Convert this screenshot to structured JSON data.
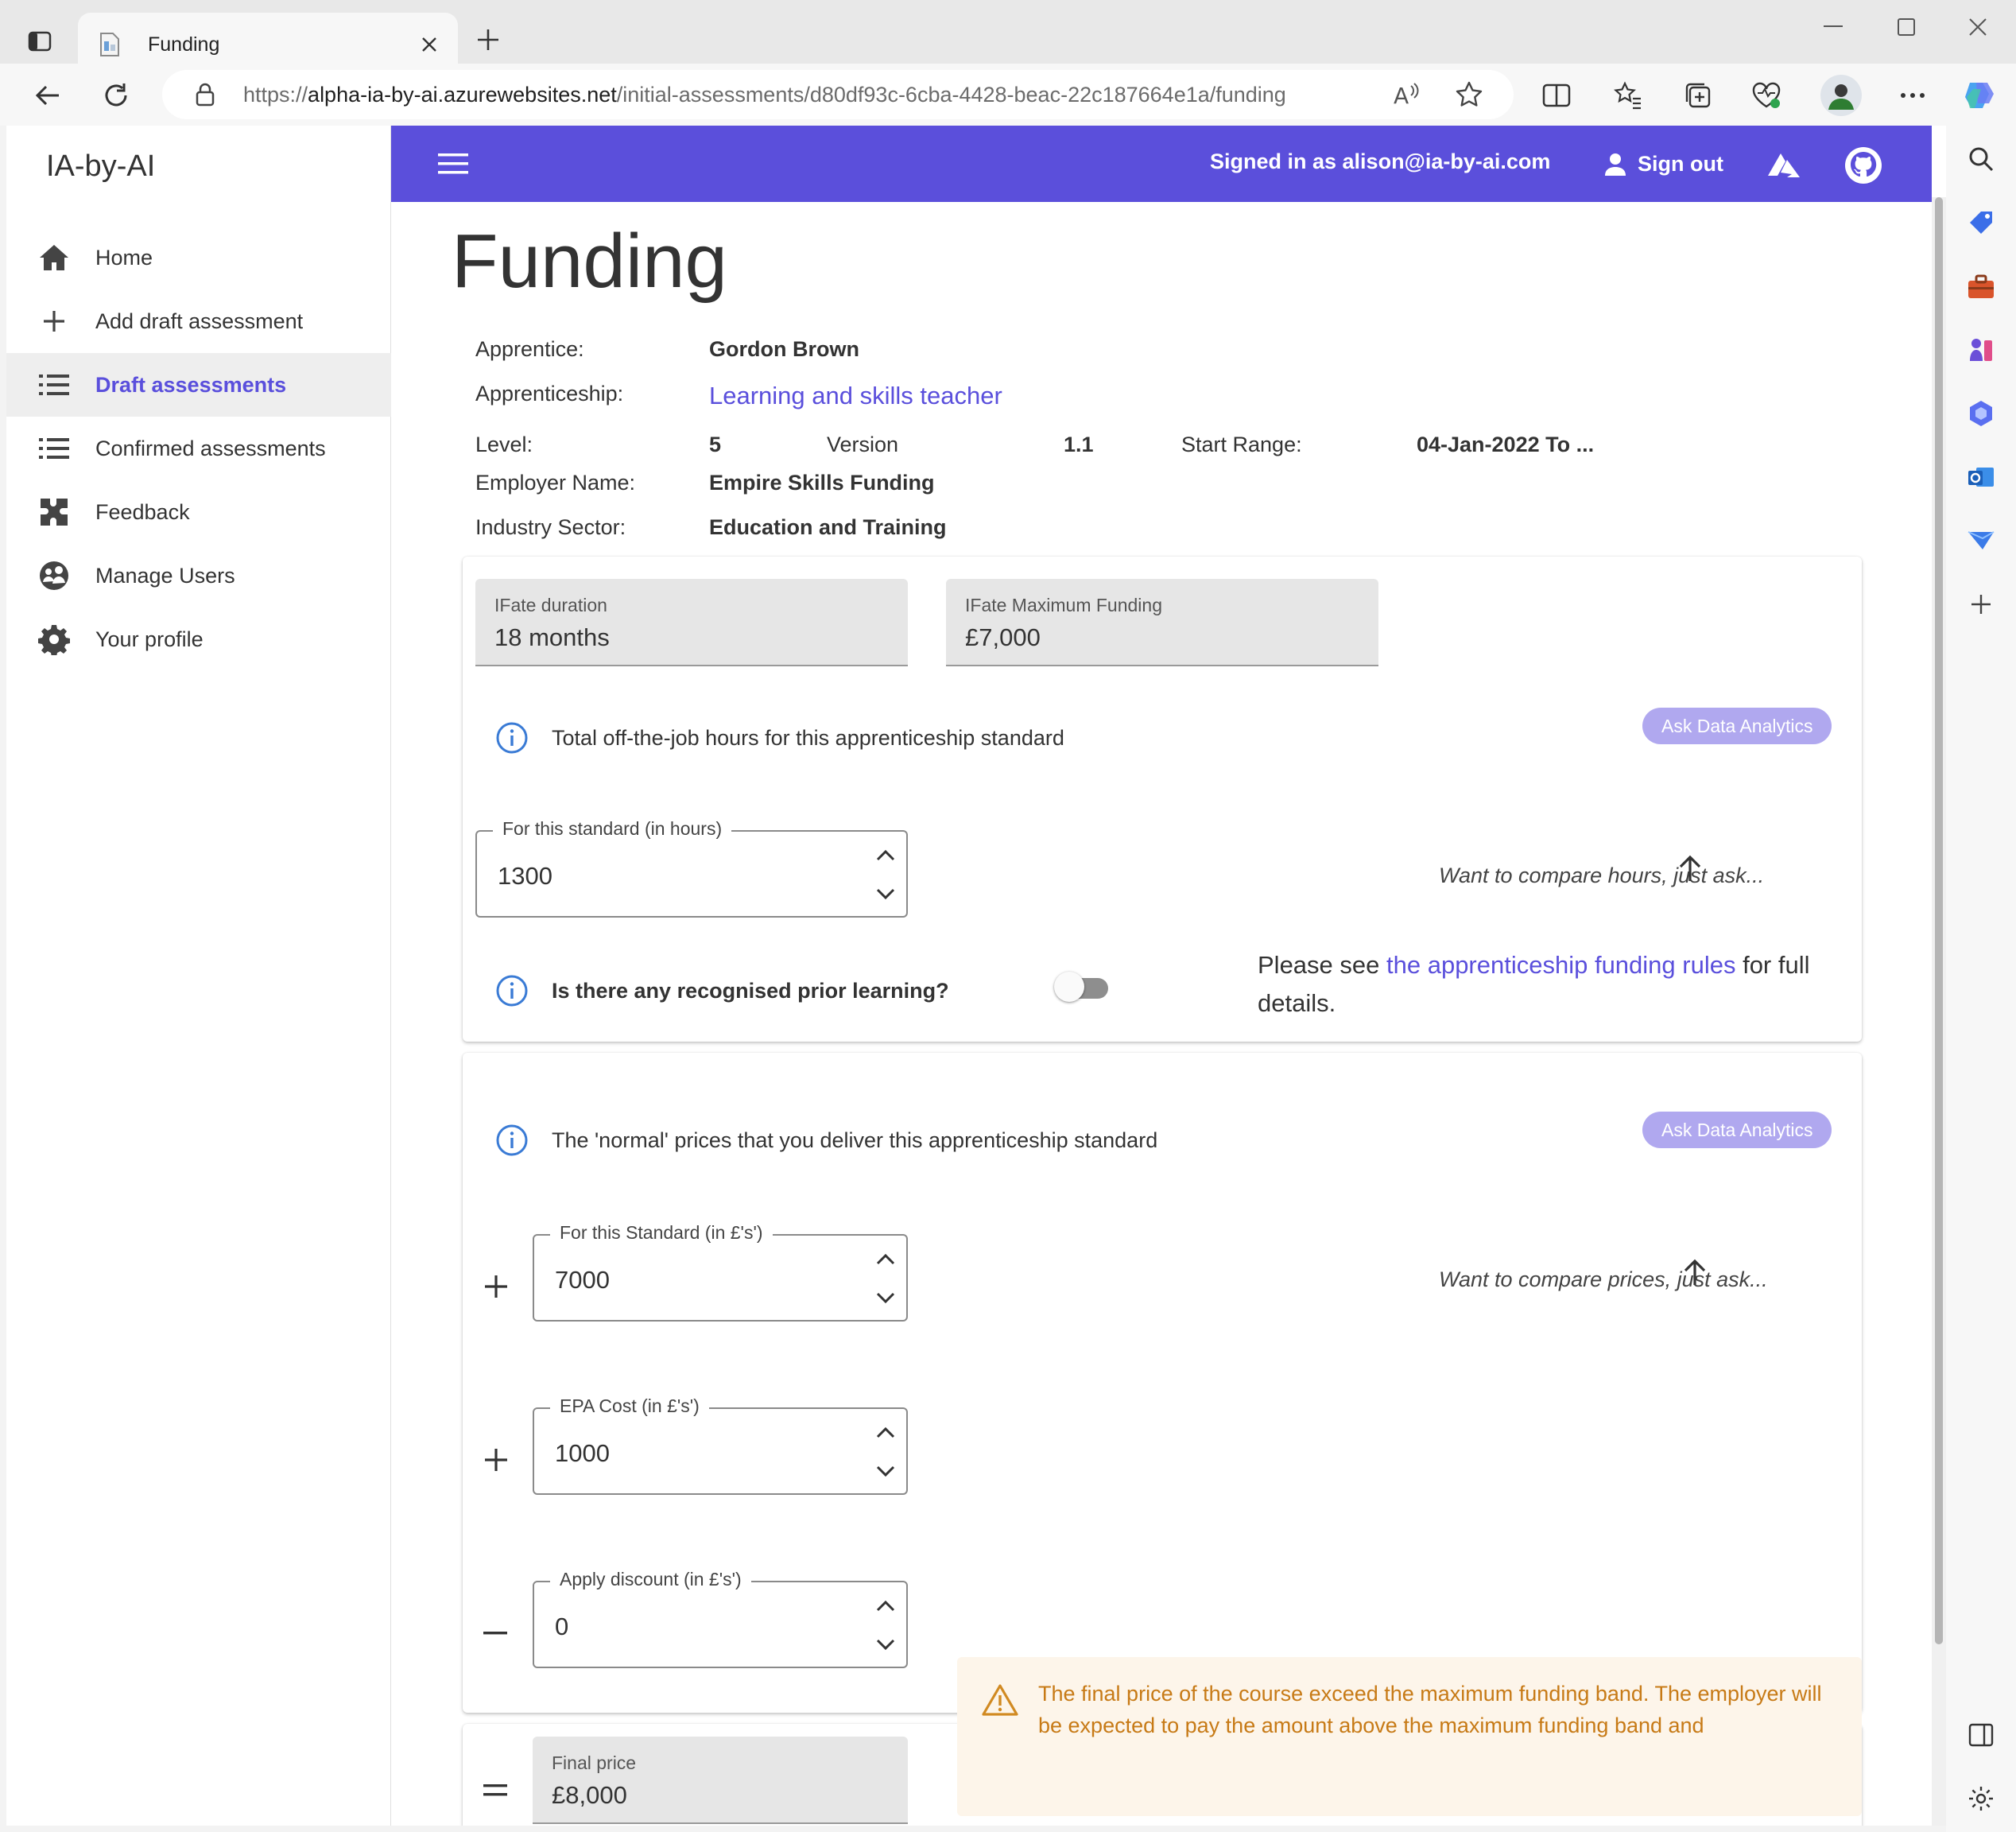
{
  "browser": {
    "tab_title": "Funding",
    "url_prefix": "https://",
    "url_host": "alpha-ia-by-ai.azurewebsites.net",
    "url_path": "/initial-assessments/d80df93c-6cba-4428-beac-22c187664e1a/funding"
  },
  "app": {
    "brand": "IA-by-AI",
    "header": {
      "signed_in": "Signed in as alison@ia-by-ai.com",
      "sign_out": "Sign out"
    },
    "sidebar": {
      "items": [
        {
          "label": "Home",
          "icon": "home-icon"
        },
        {
          "label": "Add draft assessment",
          "icon": "plus-icon"
        },
        {
          "label": "Draft assessments",
          "icon": "list-icon",
          "active": true
        },
        {
          "label": "Confirmed assessments",
          "icon": "list-icon"
        },
        {
          "label": "Feedback",
          "icon": "feedback-icon"
        },
        {
          "label": "Manage Users",
          "icon": "users-icon"
        },
        {
          "label": "Your profile",
          "icon": "gear-icon"
        }
      ]
    }
  },
  "page": {
    "title": "Funding",
    "details": {
      "apprentice_label": "Apprentice:",
      "apprentice": "Gordon Brown",
      "apprenticeship_label": "Apprenticeship:",
      "apprenticeship": "Learning and skills teacher",
      "level_label": "Level:",
      "level": "5",
      "version_label": "Version",
      "version": "1.1",
      "start_range_label": "Start Range:",
      "start_range": "04-Jan-2022 To ...",
      "employer_label": "Employer Name:",
      "employer": "Empire Skills Funding",
      "sector_label": "Industry Sector:",
      "sector": "Education and Training"
    },
    "hours_card": {
      "ifate_duration_label": "IFate duration",
      "ifate_duration": "18 months",
      "ifate_max_label": "IFate Maximum Funding",
      "ifate_max": "£7,000",
      "info_text": "Total off-the-job hours for this apprenticeship standard",
      "ask_button": "Ask Data Analytics",
      "hours_label": "For this standard (in hours)",
      "hours_value": "1300",
      "hours_hint": "Want to compare hours, just ask...",
      "rpl_question": "Is there any recognised prior learning?",
      "rpl_enabled": false,
      "rules_prefix": "Please see ",
      "rules_link": "the apprenticeship funding rules",
      "rules_suffix": " for full details."
    },
    "price_card": {
      "info_text": "The 'normal' prices that you deliver this apprenticeship standard",
      "ask_button": "Ask Data Analytics",
      "standard_label": "For this Standard (in £'s')",
      "standard_value": "7000",
      "price_hint": "Want to compare prices, just ask...",
      "epa_label": "EPA Cost (in £'s')",
      "epa_value": "1000",
      "discount_label": "Apply discount (in £'s')",
      "discount_value": "0"
    },
    "final": {
      "label": "Final price",
      "value": "£8,000",
      "warning": "The final price of the course exceed the maximum funding band. The employer will be expected to pay the amount above the maximum funding band and"
    }
  },
  "colors": {
    "header": "#5b4fdb",
    "accent": "#5a4fdc",
    "pill": "#b0a8ef",
    "warning_text": "#c77a16",
    "warning_bg": "#fdf5ea"
  }
}
